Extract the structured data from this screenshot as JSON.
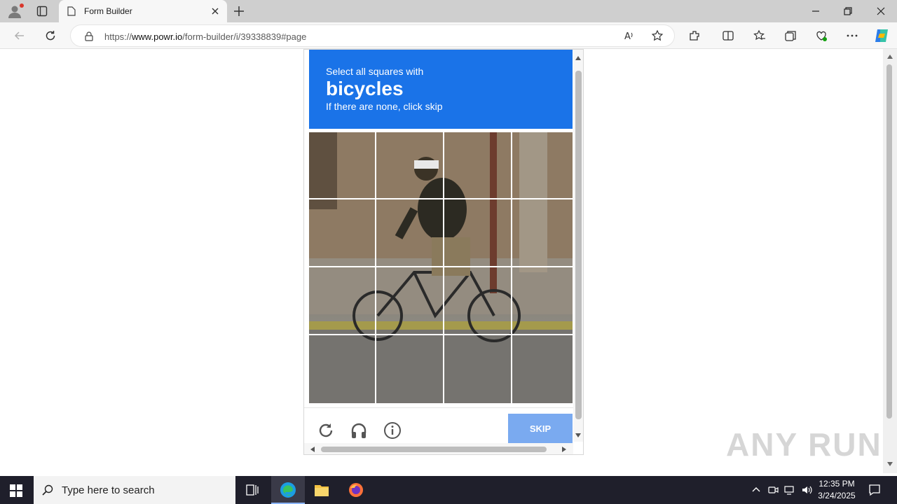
{
  "browser": {
    "tab_title": "Form Builder",
    "url_prefix": "https://",
    "url_host": "www.powr.io",
    "url_path": "/form-builder/i/39338839#page"
  },
  "captcha": {
    "instruction_line1": "Select all squares with",
    "target_word": "bicycles",
    "instruction_line3": "If there are none, click skip",
    "skip_label": "SKIP",
    "header_color": "#1a73e8",
    "skip_color": "#7aaaf0",
    "grid_rows": 4,
    "grid_cols": 4
  },
  "taskbar": {
    "search_placeholder": "Type here to search",
    "time": "12:35 PM",
    "date": "3/24/2025"
  },
  "watermark": "ANY RUN"
}
